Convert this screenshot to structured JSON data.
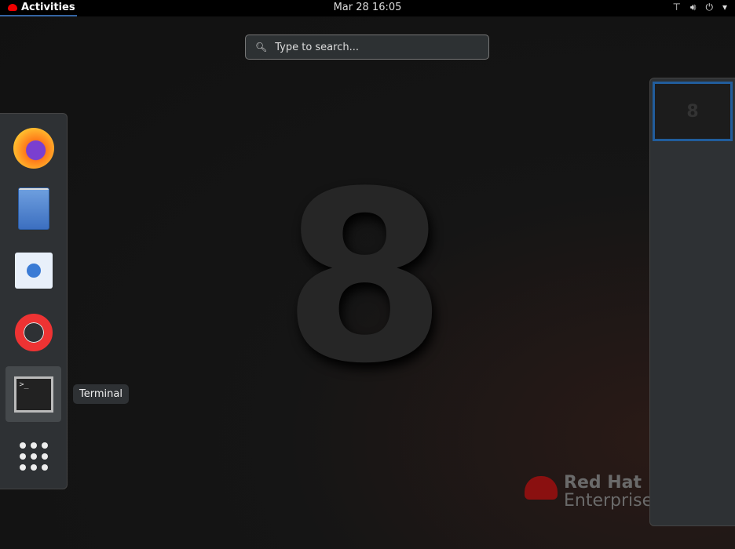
{
  "topbar": {
    "activities": "Activities",
    "clock": "Mar 28  16:05",
    "icons": [
      "network-icon",
      "volume-icon",
      "power-icon",
      "chevron-down-icon"
    ]
  },
  "search": {
    "placeholder": "Type to search..."
  },
  "dash": {
    "apps": [
      "Firefox",
      "Files",
      "Software",
      "Help",
      "Terminal",
      "Show Applications"
    ],
    "tooltip": "Terminal"
  },
  "wallpaper": {
    "number": "8",
    "brand_line1": "Red Hat",
    "brand_line2": "Enterprise"
  },
  "workspace": {
    "thumb_number": "8"
  },
  "colors": {
    "accent": "#3465a4",
    "redhat": "#cc0000"
  }
}
